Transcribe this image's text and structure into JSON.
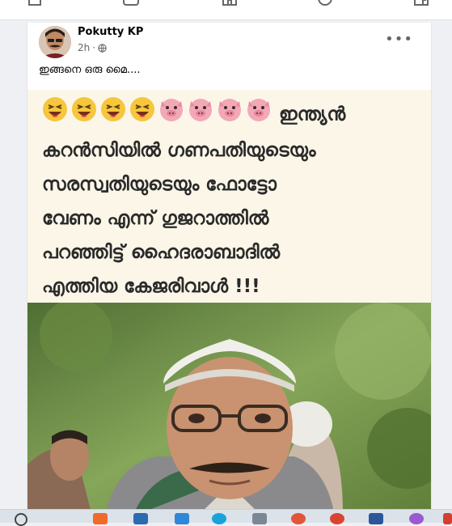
{
  "post": {
    "author": "Pokutty KP",
    "time": "2h",
    "privacy_icon": "globe-icon",
    "caption": "ഇങ്ങനെ ഒരു മൈ...."
  },
  "meme": {
    "line1": "ഇന്ത്യൻ",
    "line2": "കറൻസിയിൽ ഗണപതിയുടെയും",
    "line3": "സരസ്വതിയുടെയും ഫോട്ടോ",
    "line4": "വേണം എന്ന് ഗുജറാത്തിൽ",
    "line5": "പറഞ്ഞിട്ട് ഹൈദരാബാദിൽ",
    "line6": "എത്തിയ കേജരിവാൾ !!!"
  },
  "colors": {
    "meme_bg": "#fbf6e8",
    "text": "#2a2a2a",
    "emoji_laugh": "#f6c63d",
    "emoji_pig": "#f3a8b7"
  }
}
